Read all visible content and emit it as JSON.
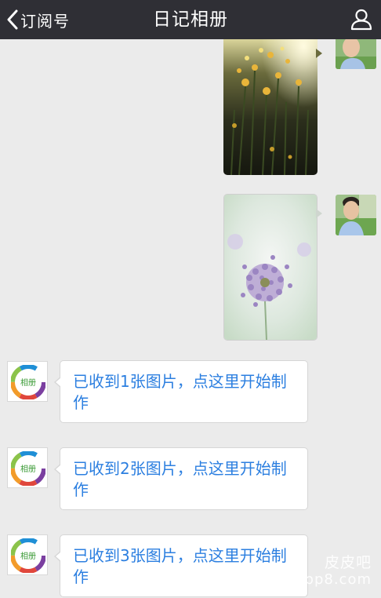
{
  "header": {
    "back_label": "订阅号",
    "title": "日记相册"
  },
  "messages": {
    "bot_avatar_label": "相册",
    "replies": [
      {
        "text": "已收到1张图片，点这里开始制作"
      },
      {
        "text": "已收到2张图片，点这里开始制作"
      },
      {
        "text": "已收到3张图片，点这里开始制作"
      }
    ]
  },
  "watermark": {
    "line1": "皮皮吧",
    "line2": "pp8.com"
  },
  "colors": {
    "navbar": "#2f2f35",
    "background": "#ebebeb",
    "link_text": "#2c7fe0"
  }
}
